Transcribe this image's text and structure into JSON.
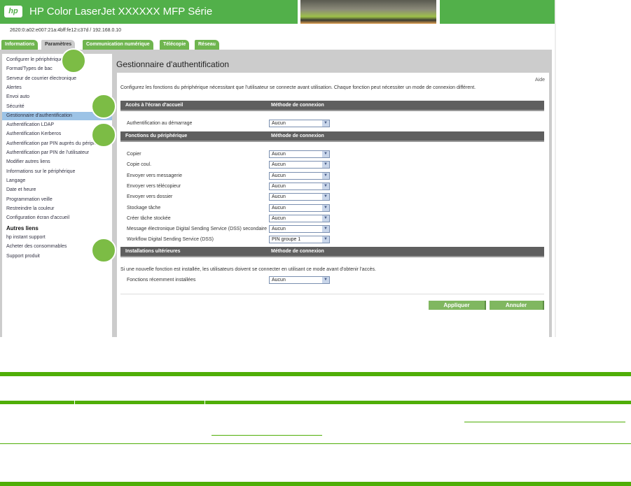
{
  "header": {
    "logo": "hp",
    "title": "HP Color LaserJet XXXXXX MFP Série",
    "address": "2620:0:a02:e007:21a:4bff:fe12:c37d / 192.168.0.10"
  },
  "tabs": [
    "Informations",
    "Paramètres",
    "Communication numérique",
    "Télécopie",
    "Réseau"
  ],
  "sidebar": {
    "items": [
      "Configurer le périphérique",
      "Format/Types de bac",
      "Serveur de courrier électronique",
      "Alertes",
      "Envoi auto",
      "Sécurité",
      "Gestionnaire d'authentification",
      "Authentification LDAP",
      "Authentification Kerberos",
      "Authentification par PIN auprès du périph",
      "Authentification par PIN de l'utilisateur",
      "Modifier autres liens",
      "Informations sur le périphérique",
      "Langage",
      "Date et heure",
      "Programmation veille",
      "Restreindre la couleur",
      "Configuration écran d'accueil"
    ],
    "other_heading": "Autres liens",
    "other_links": [
      "hp instant support",
      "Acheter des consommables",
      "Support produit"
    ]
  },
  "main": {
    "title": "Gestionnaire d'authentification",
    "help": "Aide",
    "intro": "Configurez les fonctions du périphérique nécessitant que l'utilisateur se connecte avant utilisation. Chaque fonction peut nécessiter un mode de connexion différent.",
    "method_header": "Méthode de connexion",
    "section1": {
      "title": "Accès à l'écran d'accueil",
      "rows": [
        {
          "label": "Authentification au démarrage",
          "value": "Aucun"
        }
      ]
    },
    "section2": {
      "title": "Fonctions du périphérique",
      "rows": [
        {
          "label": "Copier",
          "value": "Aucun"
        },
        {
          "label": "Copie coul.",
          "value": "Aucun"
        },
        {
          "label": "Envoyer vers messagerie",
          "value": "Aucun"
        },
        {
          "label": "Envoyer vers télécopieur",
          "value": "Aucun"
        },
        {
          "label": "Envoyer vers dossier",
          "value": "Aucun"
        },
        {
          "label": "Stockage tâche",
          "value": "Aucun"
        },
        {
          "label": "Créer tâche stockée",
          "value": "Aucun"
        },
        {
          "label": "Message électronique Digital Sending Service (DSS) secondaire",
          "value": "Aucun"
        },
        {
          "label": "Workflow Digital Sending Service (DSS)",
          "value": "PIN groupe 1"
        }
      ]
    },
    "section3": {
      "title": "Installations ultérieures",
      "note": "Si une nouvelle fonction est installée, les utilisateurs doivent se connecter en utilisant ce mode avant d'obtenir l'accès.",
      "rows": [
        {
          "label": "Fonctions récemment installées",
          "value": "Aucun"
        }
      ]
    },
    "apply": "Appliquer",
    "cancel": "Annuler"
  },
  "colors": {
    "green": "#52b04a",
    "doc_green": "#4fae07",
    "bar": "#5f5f5f"
  }
}
